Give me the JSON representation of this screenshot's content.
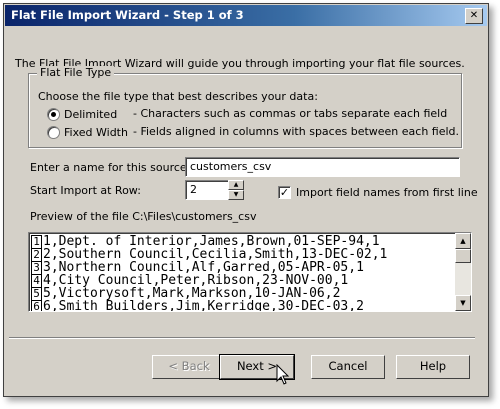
{
  "window": {
    "title": "Flat File Import Wizard - Step 1 of 3",
    "close_glyph": "✕"
  },
  "intro": "The Flat File Import Wizard will guide you through importing your flat file sources.",
  "file_type": {
    "group_label": "Flat File Type",
    "prompt": "Choose the file type that best describes your data:",
    "options": [
      {
        "label": "Delimited",
        "description": "- Characters such as commas or tabs separate each field",
        "selected": true
      },
      {
        "label": "Fixed Width",
        "description": "- Fields aligned in columns with spaces between each field.",
        "selected": false
      }
    ]
  },
  "source_name": {
    "label": "Enter a name for this source:",
    "value": "customers_csv"
  },
  "start_row": {
    "label": "Start Import at Row:",
    "value": "2",
    "up_glyph": "▲",
    "down_glyph": "▼"
  },
  "field_names": {
    "label": "Import field names from first line",
    "checked": true,
    "check_glyph": "✓"
  },
  "preview": {
    "label": "Preview of the file C:\\Files\\customers_csv",
    "rows": [
      {
        "num": "1",
        "text": "1,Dept. of Interior,James,Brown,01-SEP-94,1"
      },
      {
        "num": "2",
        "text": "2,Southern Council,Cecilia,Smith,13-DEC-02,1"
      },
      {
        "num": "3",
        "text": "3,Northern Council,Alf,Garred,05-APR-05,1"
      },
      {
        "num": "4",
        "text": "4,City Council,Peter,Ribson,23-NOV-00,1"
      },
      {
        "num": "5",
        "text": "5,Victorysoft,Mark,Markson,10-JAN-06,2"
      },
      {
        "num": "6",
        "text": "6,Smith Builders,Jim,Kerridge,30-DEC-03,2"
      }
    ],
    "scroll_up_glyph": "▲",
    "scroll_down_glyph": "▼"
  },
  "buttons": {
    "back": "< Back",
    "next": "Next >",
    "cancel": "Cancel",
    "help": "Help"
  }
}
